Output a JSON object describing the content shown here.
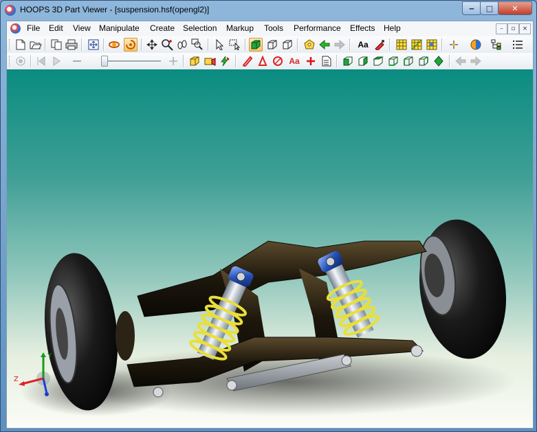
{
  "window": {
    "title": "HOOPS 3D Part Viewer - [suspension.hsf(opengl2)]",
    "caption_buttons": {
      "minimize": "‒",
      "maximize": "□",
      "close": "✕"
    }
  },
  "menubar": {
    "items": [
      "File",
      "Edit",
      "View",
      "Manipulate",
      "Create",
      "Selection",
      "Markup",
      "Tools",
      "Performance",
      "Effects",
      "Help"
    ],
    "mdi_buttons": [
      "–",
      "▫",
      "×"
    ]
  },
  "toolbar1": {
    "icons": [
      "new-icon",
      "open-icon",
      "copy-icon",
      "print-icon",
      "fit-window-icon",
      "orbit-icon",
      "turntable-icon",
      "pan-icon",
      "zoom-icon",
      "walk-icon",
      "zoom-window-icon",
      "select-icon",
      "select-area-icon",
      "shaded-icon",
      "wireframe-icon",
      "hidden-line-icon",
      "home-view-icon",
      "back-arrow-icon",
      "forward-arrow-icon",
      "text-icon",
      "annotate-icon",
      "grid-1-icon",
      "grid-2-icon",
      "grid-3-icon",
      "point-icon",
      "render-mode-icon",
      "hierarchy-icon",
      "list-icon"
    ],
    "text_button": "Aa"
  },
  "toolbar2": {
    "icons": [
      "record-icon",
      "rewind-icon",
      "play-icon",
      "stop-icon",
      "slider-icon",
      "plus-icon",
      "measure-box-icon",
      "camera-icon",
      "lightning-icon",
      "pencil-icon",
      "polygon-icon",
      "circle-icon",
      "markup-text-icon",
      "markup-cross-icon",
      "note-icon",
      "cube-front-icon",
      "cube-back-icon",
      "cube-top-icon",
      "cube-bottom-icon",
      "cube-left-icon",
      "cube-right-icon",
      "iso-view-icon",
      "prev-view-icon",
      "next-view-icon"
    ],
    "text_button": "Aa"
  },
  "viewport": {
    "background_top": "#0a8c80",
    "background_bottom": "#fbfcf6",
    "triad": {
      "y_label": "Y",
      "z_label": "Z"
    }
  }
}
